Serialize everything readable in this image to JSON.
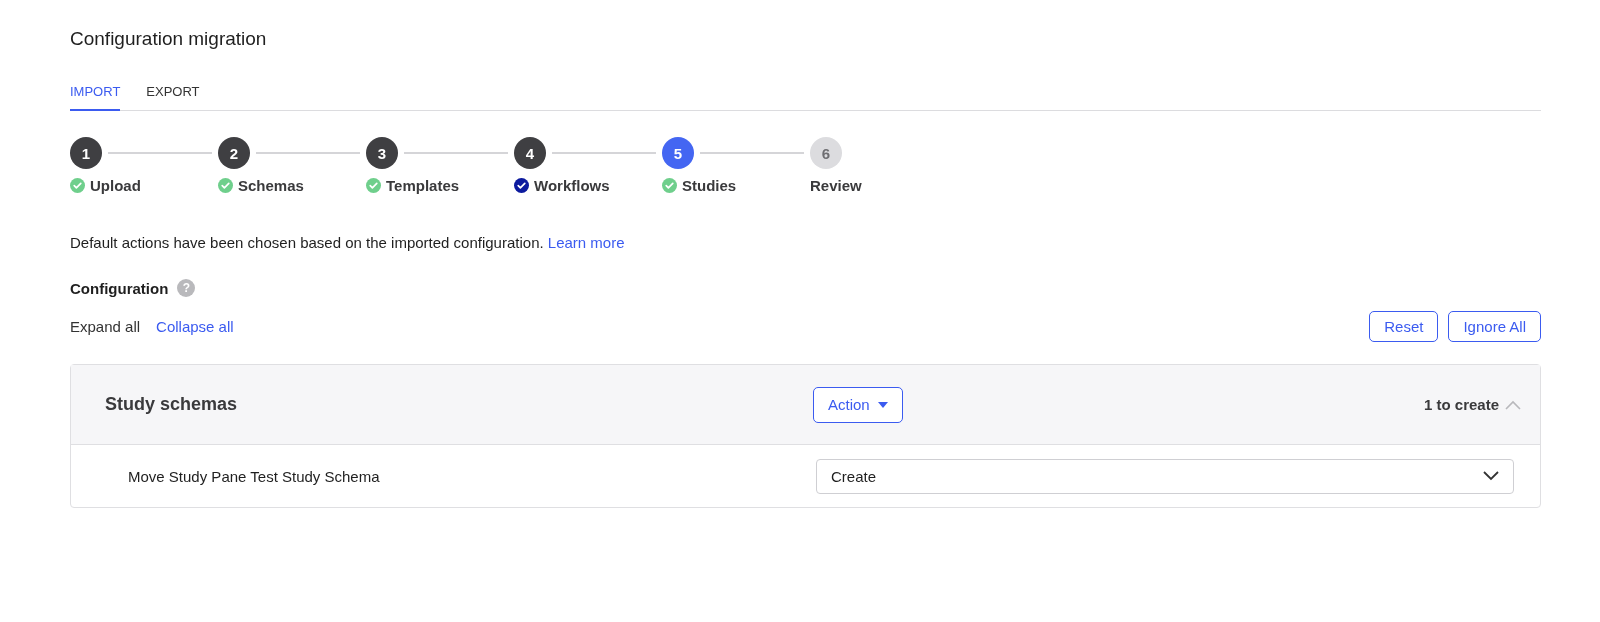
{
  "page": {
    "title": "Configuration migration"
  },
  "tabs": [
    {
      "label": "IMPORT",
      "selected": true
    },
    {
      "label": "EXPORT",
      "selected": false
    }
  ],
  "steps": [
    {
      "number": "1",
      "label": "Upload",
      "kind": "done",
      "color": "#6fcf8c"
    },
    {
      "number": "2",
      "label": "Schemas",
      "kind": "done",
      "color": "#6fcf8c"
    },
    {
      "number": "3",
      "label": "Templates",
      "kind": "done",
      "color": "#6fcf8c"
    },
    {
      "number": "4",
      "label": "Workflows",
      "kind": "done",
      "color": "#0c1a9e"
    },
    {
      "number": "5",
      "label": "Studies",
      "kind": "current",
      "color": "#6fcf8c"
    },
    {
      "number": "6",
      "label": "Review",
      "kind": "upcoming"
    }
  ],
  "intro": {
    "text": "Default actions have been chosen based on the imported configuration.",
    "link": "Learn more"
  },
  "configuration": {
    "heading": "Configuration",
    "help_icon": "?",
    "expand_all": "Expand all",
    "collapse_all": "Collapse all",
    "buttons": [
      "Reset",
      "Ignore All"
    ]
  },
  "sections": [
    {
      "title": "Study schemas",
      "action": "Action",
      "count": "1 to create",
      "expanded": true,
      "rows": [
        {
          "name": "Move Study Pane Test Study Schema",
          "value": "Create"
        }
      ]
    }
  ]
}
